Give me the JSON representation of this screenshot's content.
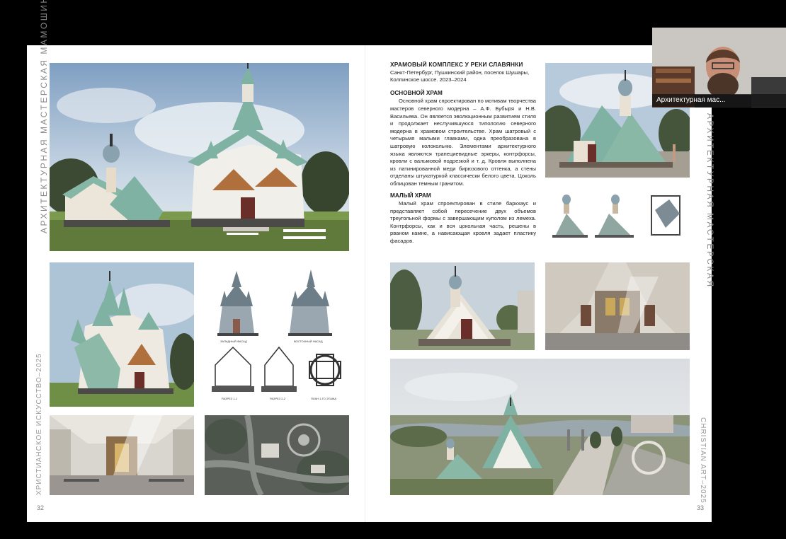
{
  "window": {
    "video_participant_label": "Архитектурная мас..."
  },
  "left_page": {
    "side_title": "АРХИТЕКТУРНАЯ МАСТЕРСКАЯ МАМОШИНА",
    "side_footer": "ХРИСТИАНСКОЕ ИСКУССТВО–2025",
    "page_number": "32"
  },
  "right_page": {
    "side_title": "АРХИТЕКТУРНАЯ МАСТЕРСКАЯ",
    "side_footer": "CHRISTIAN ART–2025",
    "page_number": "33"
  },
  "article": {
    "title": "ХРАМОВЫЙ КОМПЛЕКС У РЕКИ СЛАВЯНКИ",
    "subtitle": "Санкт-Петербург, Пушкинский район, поселок Шушары, Колпинское шоссе. 2023–2024",
    "sections": [
      {
        "heading": "ОСНОВНОЙ ХРАМ",
        "text": "Основной храм спроектирован по мотивам творчества мастеров северного модерна – А.Ф. Бубыря и Н.В. Васильева. Он является эволюционным развитием стиля и продолжает неслучившуюся типологию северного модерна в храмовом строительстве. Храм шатровый с четырьмя малыми главками, одна преобразована в шатровую колокольню. Элементами архитектурного языка являются трапециевидные эркеры, контрфорсы, кровли с вальмовой подрезкой и т. д. Кровля выполнена из патинированной меди бирюзового оттенка, а стены отделаны штукатуркой классически белого цвета. Цоколь облицован темным гранитом."
      },
      {
        "heading": "МАЛЫЙ ХРАМ",
        "text": "Малый храм спроектирован в стиле баркхаус и представляет собой пересечение двух объемов треугольной формы с завершающим куполом из лемеха. Контрфорсы, как и вся цокольная часть, решены в рваном камне, а нависающая кровля задает пластику фасадов."
      }
    ]
  },
  "drawings": {
    "facade_west": "ЗАПАДНЫЙ ФАСАД",
    "facade_east": "ВОСТОЧНЫЙ ФАСАД",
    "section_1": "РАЗРЕЗ 1-1",
    "section_2": "РАЗРЕЗ 2-2",
    "plan": "ПЛАН 1-ГО ЭТАЖА"
  },
  "colors": {
    "roof_patina": "#7fb2a2",
    "wall_white": "#f1efe9",
    "granite": "#4c4a48",
    "sky": "#c8d6e3",
    "grass": "#7c9a4e"
  }
}
